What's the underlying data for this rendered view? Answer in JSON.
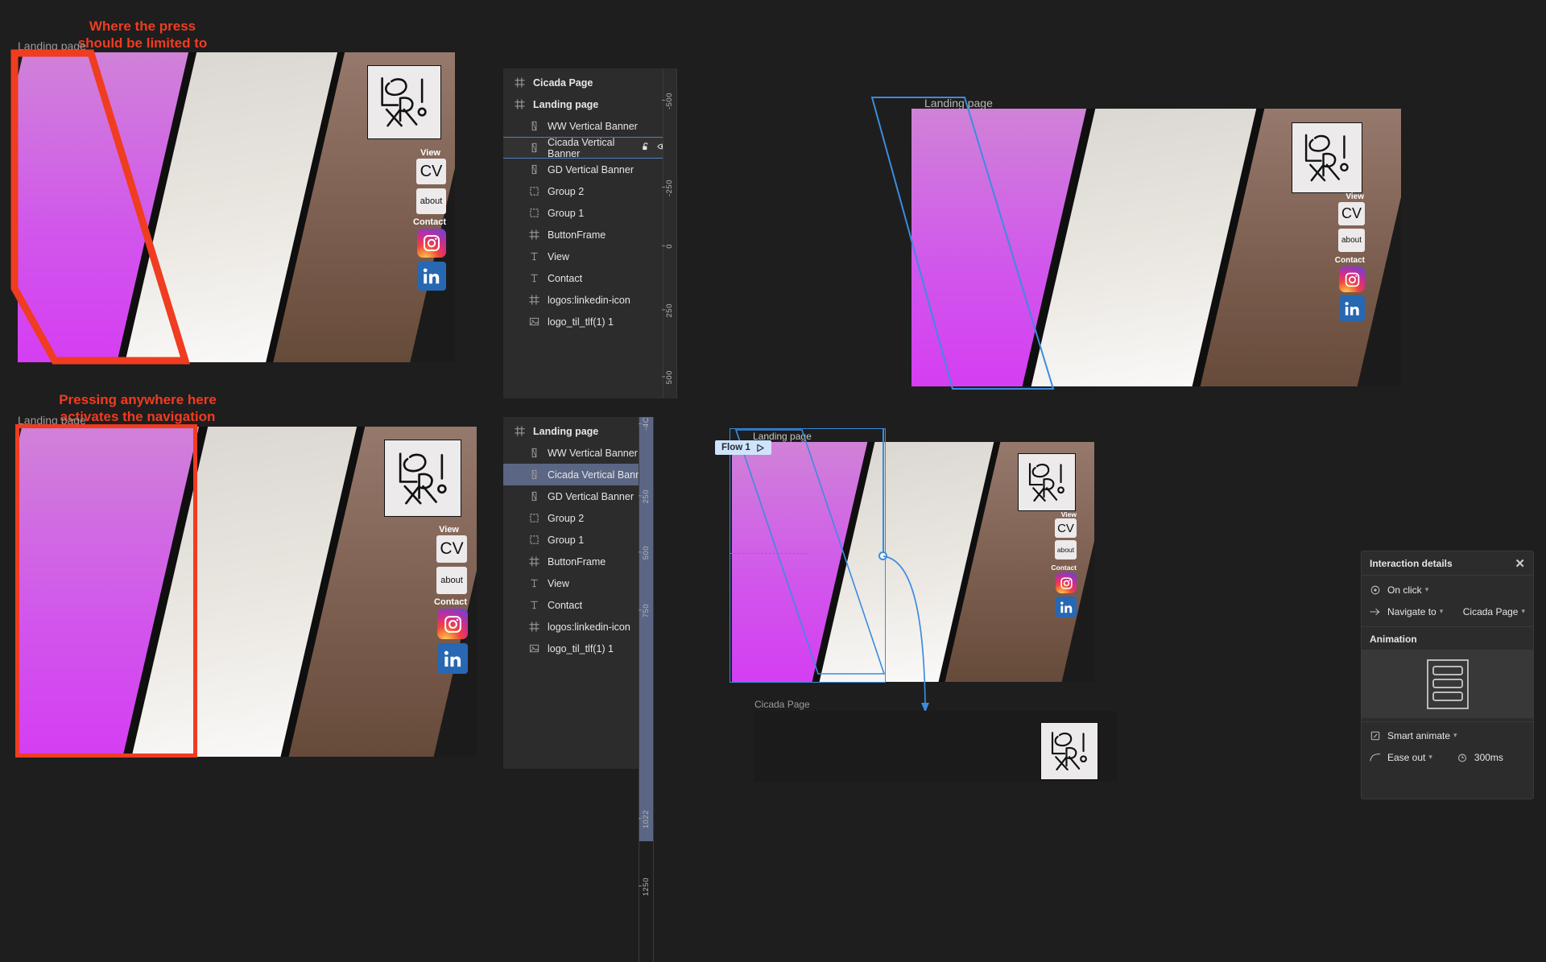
{
  "annotations": {
    "top": "Where the press\nshould be limited to",
    "bottom": "Pressing anywhere here\nactivates the navigation"
  },
  "frames": {
    "landing_page_label": "Landing page",
    "cicada_page_label": "Cicada Page"
  },
  "mock": {
    "view_label": "View",
    "cv_label": "CV",
    "about_label": "about",
    "contact_label": "Contact",
    "instagram_icon": "instagram-icon",
    "linkedin_icon": "linkedin-icon",
    "logo_icon": "lsr-logo-icon"
  },
  "layers_panel_top": {
    "rows": [
      {
        "label": "Cicada Page",
        "icon": "frame-icon",
        "indent": 0,
        "bold": true,
        "state": "none"
      },
      {
        "label": "Landing page",
        "icon": "frame-icon",
        "indent": 0,
        "bold": true,
        "state": "none"
      },
      {
        "label": "WW Vertical Banner",
        "icon": "vector-icon",
        "indent": 1,
        "bold": false,
        "state": "none"
      },
      {
        "label": "Cicada Vertical Banner",
        "icon": "vector-icon",
        "indent": 1,
        "bold": false,
        "state": "outline",
        "lock_icon": "unlock-icon",
        "visible_icon": "eye-icon"
      },
      {
        "label": "GD Vertical Banner",
        "icon": "vector-icon",
        "indent": 1,
        "bold": false,
        "state": "none"
      },
      {
        "label": "Group 2",
        "icon": "group-icon",
        "indent": 1,
        "bold": false,
        "state": "none"
      },
      {
        "label": "Group 1",
        "icon": "group-icon",
        "indent": 1,
        "bold": false,
        "state": "none"
      },
      {
        "label": "ButtonFrame",
        "icon": "frame-icon",
        "indent": 1,
        "bold": false,
        "state": "none"
      },
      {
        "label": "View",
        "icon": "text-icon",
        "indent": 1,
        "bold": false,
        "state": "none"
      },
      {
        "label": "Contact",
        "icon": "text-icon",
        "indent": 1,
        "bold": false,
        "state": "none"
      },
      {
        "label": "logos:linkedin-icon",
        "icon": "frame-icon",
        "indent": 1,
        "bold": false,
        "state": "none"
      },
      {
        "label": "logo_til_tlf(1) 1",
        "icon": "image-icon",
        "indent": 1,
        "bold": false,
        "state": "none"
      }
    ],
    "ruler_ticks": [
      "-500",
      "-250",
      "0",
      "250",
      "500"
    ]
  },
  "layers_panel_bottom": {
    "rows": [
      {
        "label": "Landing page",
        "icon": "frame-icon",
        "indent": 0,
        "bold": true,
        "state": "none"
      },
      {
        "label": "WW Vertical Banner",
        "icon": "vector-icon",
        "indent": 1,
        "bold": false,
        "state": "none"
      },
      {
        "label": "Cicada Vertical Banner",
        "icon": "vector-icon",
        "indent": 1,
        "bold": false,
        "state": "filled"
      },
      {
        "label": "GD Vertical Banner",
        "icon": "vector-icon",
        "indent": 1,
        "bold": false,
        "state": "none"
      },
      {
        "label": "Group 2",
        "icon": "group-icon",
        "indent": 1,
        "bold": false,
        "state": "none"
      },
      {
        "label": "Group 1",
        "icon": "group-icon",
        "indent": 1,
        "bold": false,
        "state": "none"
      },
      {
        "label": "ButtonFrame",
        "icon": "frame-icon",
        "indent": 1,
        "bold": false,
        "state": "none"
      },
      {
        "label": "View",
        "icon": "text-icon",
        "indent": 1,
        "bold": false,
        "state": "none"
      },
      {
        "label": "Contact",
        "icon": "text-icon",
        "indent": 1,
        "bold": false,
        "state": "none"
      },
      {
        "label": "logos:linkedin-icon",
        "icon": "frame-icon",
        "indent": 1,
        "bold": false,
        "state": "none"
      },
      {
        "label": "logo_til_tlf(1) 1",
        "icon": "image-icon",
        "indent": 1,
        "bold": false,
        "state": "none"
      }
    ],
    "ruler_ticks": [
      "-4C",
      "250",
      "500",
      "750",
      "1022",
      "1250"
    ]
  },
  "flow": {
    "badge_label": "Flow 1",
    "play_icon": "play-icon"
  },
  "interaction_details": {
    "title": "Interaction details",
    "close_icon": "close-icon",
    "trigger": "On click",
    "trigger_icon": "click-icon",
    "action": "Navigate to",
    "action_icon": "arrow-right-icon",
    "destination": "Cicada Page",
    "animation_title": "Animation",
    "animation_preview_icon": "slide-layers-icon",
    "animation_type": "Smart animate",
    "animation_type_icon": "smart-animate-icon",
    "easing": "Ease out",
    "easing_icon": "ease-curve-icon",
    "duration": "300ms",
    "duration_icon": "timer-icon"
  },
  "colors": {
    "accent_red": "#f03c20",
    "accent_blue": "#3b8ce0",
    "selection_blue": "#5a6684",
    "panel_bg": "#2c2c2c",
    "canvas_bg": "#1e1e1e"
  }
}
